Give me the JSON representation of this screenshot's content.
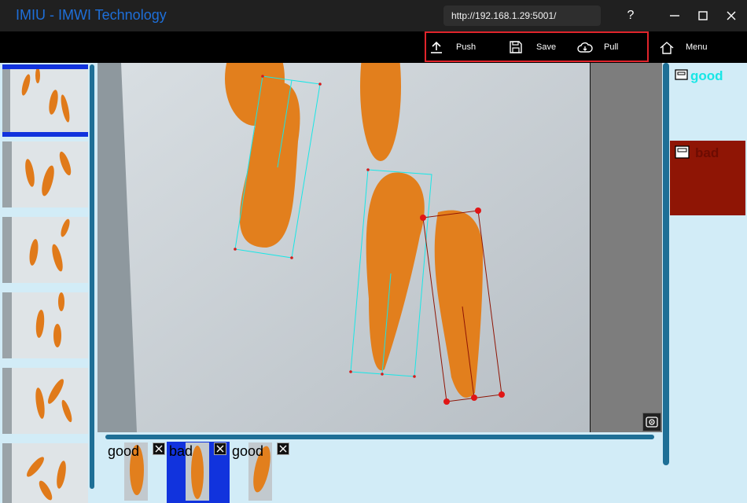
{
  "app": {
    "title": "IMIU - IMWI Technology",
    "url": "http://192.168.1.29:5001/"
  },
  "window": {
    "help_label": "?",
    "minimize_icon": "minimize-icon",
    "maximize_icon": "maximize-icon",
    "close_icon": "close-icon"
  },
  "toolbar": {
    "push_label": "Push",
    "save_label": "Save",
    "pull_label": "Pull",
    "menu_label": "Menu",
    "highlight_color": "#e0242b"
  },
  "labels": [
    {
      "name": "good",
      "color": "#19e6e6",
      "icon": "label-tag-icon"
    },
    {
      "name": "bad",
      "color": "#8f1505",
      "icon": "label-tag-icon",
      "selected": true
    }
  ],
  "annotations": [
    {
      "label": "good",
      "active": false
    },
    {
      "label": "bad",
      "active": true
    },
    {
      "label": "good",
      "active": false
    }
  ],
  "thumbnails": {
    "count": 6,
    "selected_index": 0
  },
  "colors": {
    "accent": "#1e6fd9",
    "good_box": "#19e6e6",
    "bad_box": "#8f1505",
    "selected": "#1133dd"
  }
}
